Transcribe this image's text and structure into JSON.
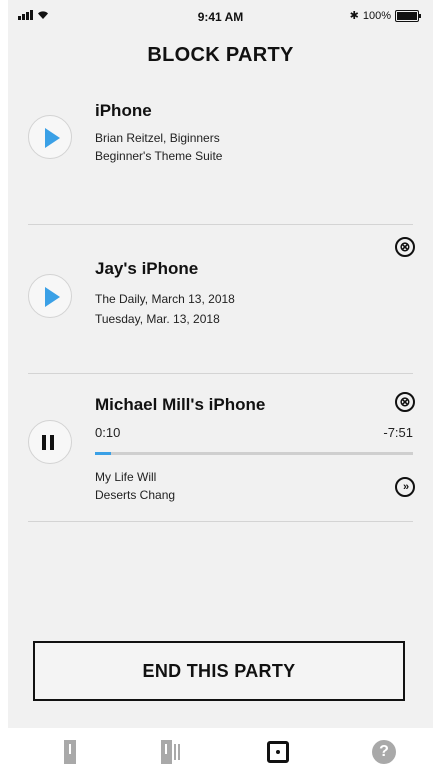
{
  "status_bar": {
    "time": "9:41 AM",
    "battery": "100%",
    "bluetooth_symbol": "✱"
  },
  "header": {
    "title": "BLOCK PARTY"
  },
  "devices": [
    {
      "name": "iPhone",
      "line1": "Brian Reitzel, Biginners",
      "line2": "Beginner's Theme Suite",
      "state": "play",
      "removable": false
    },
    {
      "name": "Jay's iPhone",
      "line1": "The Daily, March 13, 2018",
      "line2": "Tuesday, Mar. 13, 2018",
      "state": "play",
      "removable": true
    },
    {
      "name": "Michael Mill's iPhone",
      "elapsed": "0:10",
      "remaining": "-7:51",
      "progress": 0.05,
      "line1": "My Life Will",
      "line2": "Deserts Chang",
      "state": "pause",
      "removable": true
    }
  ],
  "icons": {
    "close": "⊗",
    "skip": "»",
    "help": "?"
  },
  "end_button": {
    "label": "END THIS PARTY"
  },
  "tabbar": {
    "items": [
      {
        "icon": "phone-icon",
        "active": false
      },
      {
        "icon": "multi-phone-icon",
        "active": false
      },
      {
        "icon": "party-icon",
        "active": true
      },
      {
        "icon": "help-icon",
        "active": false
      }
    ]
  },
  "colors": {
    "accent": "#3aa0e6",
    "background": "#f1f1f1",
    "inactive_icon": "#a9a9a9"
  }
}
